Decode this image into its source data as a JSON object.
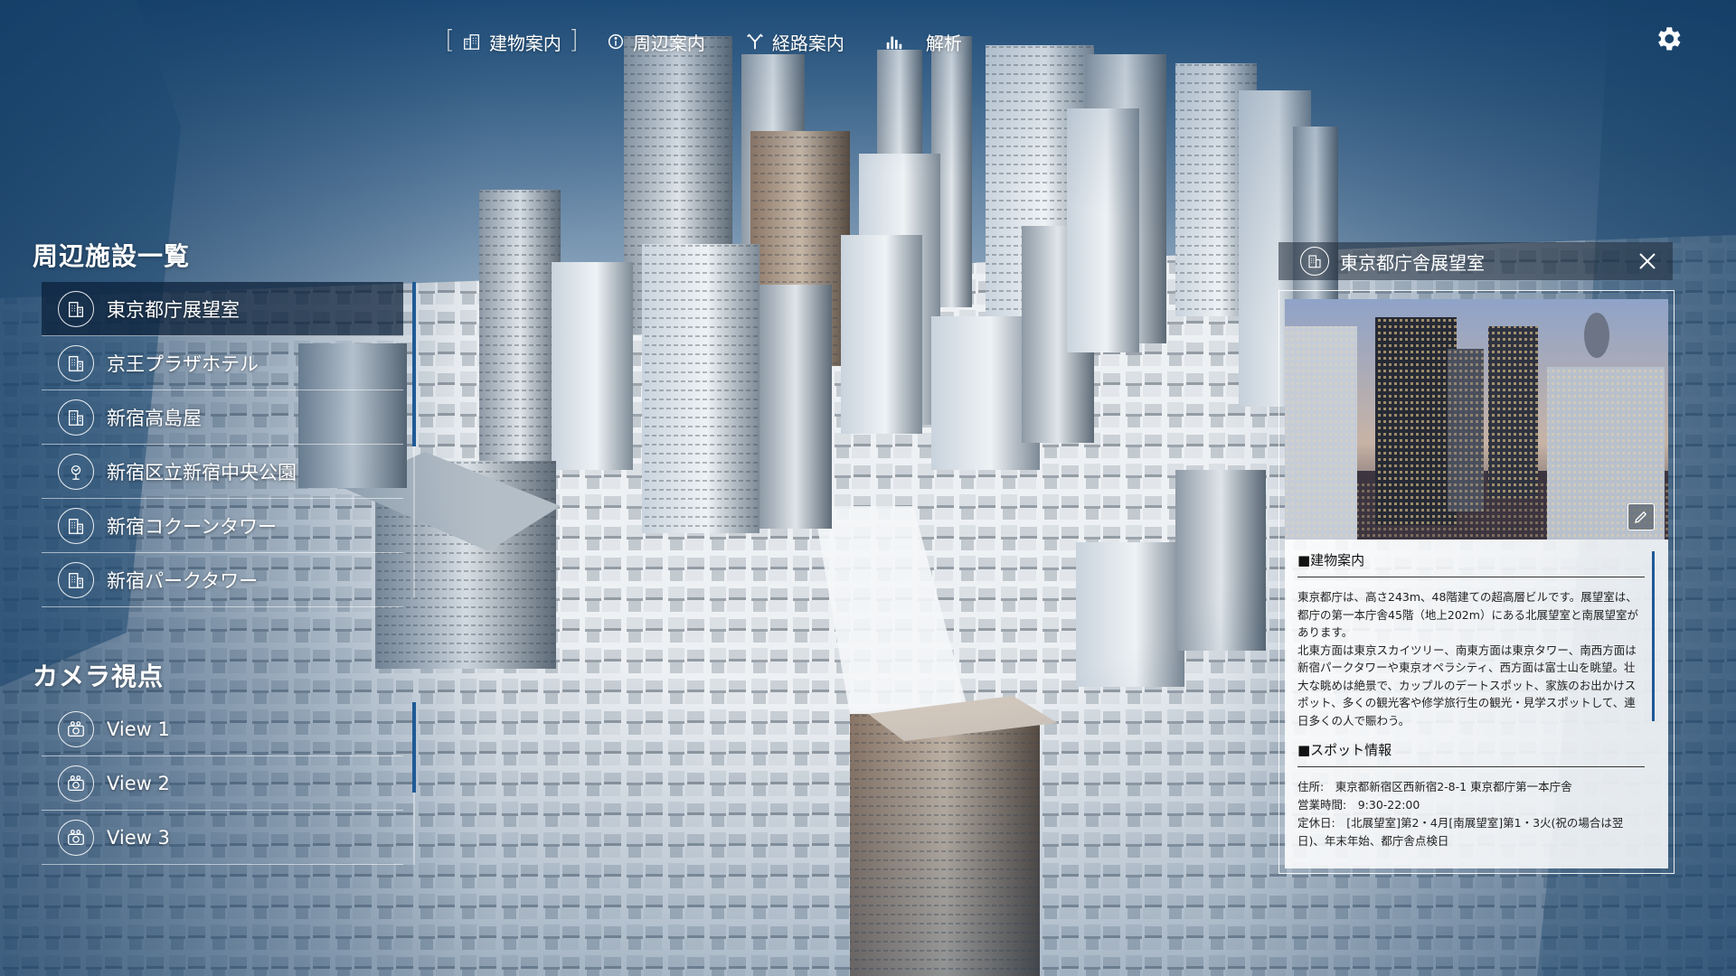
{
  "nav": {
    "items": [
      {
        "label": "建物案内",
        "icon": "building-icon"
      },
      {
        "label": "周辺案内",
        "icon": "info-icon"
      },
      {
        "label": "経路案内",
        "icon": "route-icon"
      },
      {
        "label": "解析",
        "icon": "analysis-icon"
      }
    ],
    "bracket_left": "[",
    "bracket_right": "]"
  },
  "settings": {
    "icon": "gear-icon"
  },
  "facilities": {
    "title": "周辺施設一覧",
    "items": [
      {
        "label": "東京都庁展望室",
        "icon": "building-icon",
        "active": true
      },
      {
        "label": "京王プラザホテル",
        "icon": "building-icon"
      },
      {
        "label": "新宿高島屋",
        "icon": "building-icon"
      },
      {
        "label": "新宿区立新宿中央公園",
        "icon": "park-icon"
      },
      {
        "label": "新宿コクーンタワー",
        "icon": "building-icon"
      },
      {
        "label": "新宿パークタワー",
        "icon": "building-icon"
      }
    ]
  },
  "camera": {
    "title": "カメラ視点",
    "items": [
      {
        "label": "View 1",
        "icon": "camera-icon"
      },
      {
        "label": "View 2",
        "icon": "camera-icon"
      },
      {
        "label": "View 3",
        "icon": "camera-icon"
      }
    ]
  },
  "detail": {
    "title": "東京都庁舎展望室",
    "section1_heading": "■建物案内",
    "section1_text": "東京都庁は、高さ243m、48階建ての超高層ビルです。展望室は、都庁の第一本庁舎45階（地上202m）にある北展望室と南展望室があります。\n北東方面は東京スカイツリー、南東方面は東京タワー、南西方面は新宿パークタワーや東京オペラシティ、西方面は富士山を眺望。壮大な眺めは絶景で、カップルのデートスポット、家族のお出かけスポット、多くの観光客や修学旅行生の観光・見学スポットして、連日多くの人で賑わう。",
    "section2_heading": "■スポット情報",
    "address": "住所:　東京都新宿区西新宿2-8-1 東京都庁第一本庁舎",
    "hours": "営業時間:　9:30-22:00",
    "closed": "定休日:　[北展望室]第2・4月[南展望室]第1・3火(祝の場合は翌日)、年末年始、都庁舎点検日"
  }
}
